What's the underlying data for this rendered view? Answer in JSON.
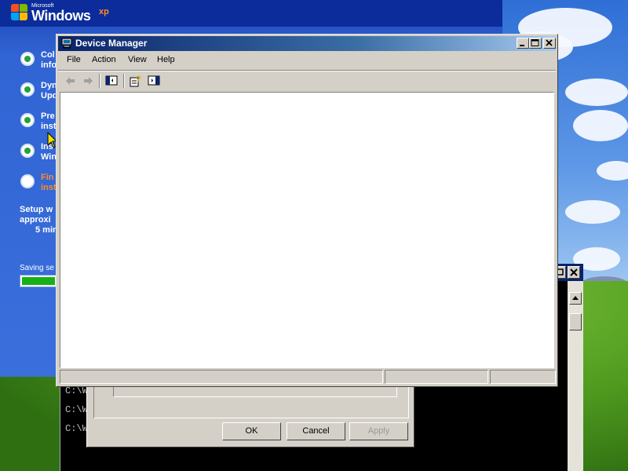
{
  "setup": {
    "logo": {
      "microsoft": "Microsoft",
      "windows": "Windows",
      "xp": "xp"
    },
    "steps": [
      {
        "line1": "Col",
        "line2": "info",
        "status": "done"
      },
      {
        "line1": "Dyn",
        "line2": "Upd",
        "status": "done"
      },
      {
        "line1": "Pre",
        "line2": "inst",
        "status": "done"
      },
      {
        "line1": "Ins",
        "line2": "Win",
        "status": "done"
      },
      {
        "line1": "Fin",
        "line2": "inst",
        "status": "pending"
      }
    ],
    "time_estimate": [
      "Setup w",
      "approxi",
      "5 min"
    ],
    "progress_label": "Saving se",
    "progress_value": 0.95
  },
  "cmd": {
    "lines": [
      "C:\\W",
      "C:\\W",
      "C:\\W"
    ]
  },
  "dialog": {
    "ok_label": "OK",
    "cancel_label": "Cancel",
    "apply_label": "Apply"
  },
  "device_manager": {
    "title": "Device Manager",
    "menu": [
      "File",
      "Action",
      "View",
      "Help"
    ],
    "toolbar_icons": [
      "back-icon",
      "forward-icon",
      "show-hide-console-tree-icon",
      "properties-help-icon",
      "show-hide-action-pane-icon"
    ],
    "status_panes": [
      "",
      "",
      ""
    ]
  },
  "colors": {
    "titlebar_start": "#0a246a",
    "titlebar_end": "#a6caf0",
    "window_face": "#d4d0c8",
    "setup_accent": "#ff8c28",
    "progress_fill": "#18b018"
  }
}
